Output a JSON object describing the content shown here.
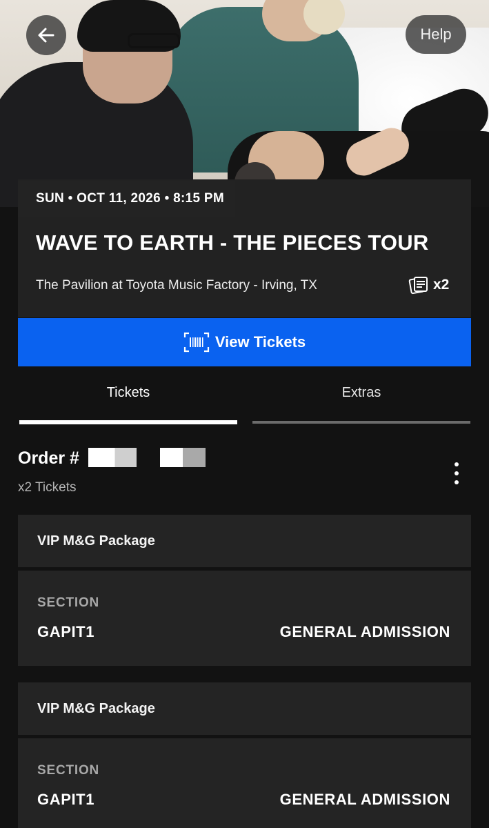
{
  "header": {
    "back_icon": "arrow-left-icon",
    "help_label": "Help"
  },
  "event": {
    "date": "SUN • OCT 11, 2026 • 8:15 PM",
    "title": "WAVE TO EARTH - THE PIECES TOUR",
    "venue": "The Pavilion at Toyota Music Factory - Irving, TX",
    "ticket_count": "x2",
    "ticket_count_icon": "tickets-icon"
  },
  "view_tickets": {
    "label": "View Tickets",
    "icon": "barcode-icon",
    "color": "#0a62f0"
  },
  "tabs": [
    {
      "label": "Tickets",
      "active": true
    },
    {
      "label": "Extras",
      "active": false
    }
  ],
  "order": {
    "label": "Order #",
    "tickets_label": "x2 Tickets",
    "menu_icon": "more-vertical-icon"
  },
  "tickets": [
    {
      "package": "VIP M&G Package",
      "section_label": "SECTION",
      "section_value": "GAPIT1",
      "admission": "GENERAL ADMISSION"
    },
    {
      "package": "VIP M&G Package",
      "section_label": "SECTION",
      "section_value": "GAPIT1",
      "admission": "GENERAL ADMISSION"
    }
  ]
}
